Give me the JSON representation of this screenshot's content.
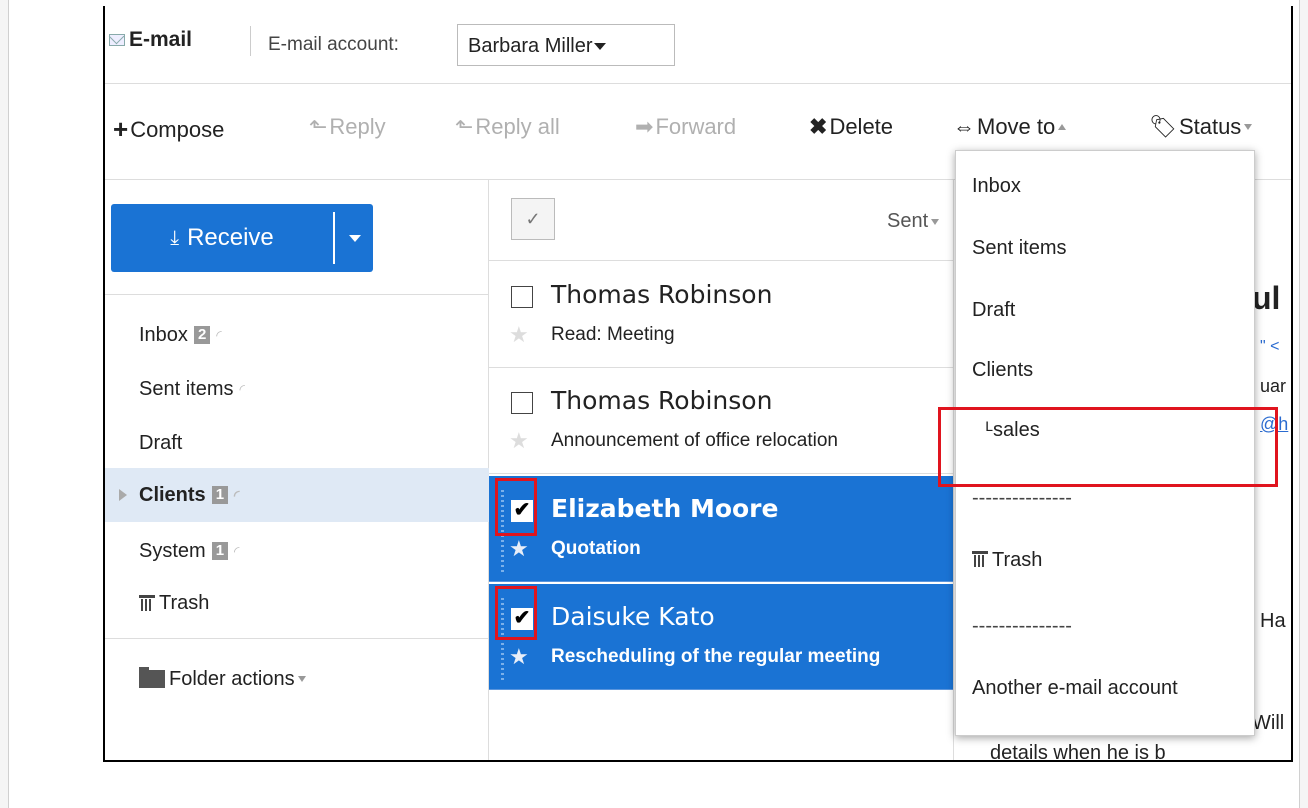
{
  "header": {
    "title": "E-mail",
    "account_label": "E-mail account:",
    "account_value": "Barbara Miller"
  },
  "toolbar": {
    "compose": "Compose",
    "reply": "Reply",
    "reply_all": "Reply all",
    "forward": "Forward",
    "delete": "Delete",
    "move_to": "Move to",
    "status": "Status"
  },
  "sidebar": {
    "receive": "Receive",
    "folders": [
      {
        "label": "Inbox",
        "badge": "2"
      },
      {
        "label": "Sent items",
        "badge": ""
      },
      {
        "label": "Draft",
        "badge": ""
      },
      {
        "label": "Clients",
        "badge": "1"
      },
      {
        "label": "System",
        "badge": "1"
      },
      {
        "label": "Trash",
        "badge": ""
      }
    ],
    "folder_actions": "Folder actions"
  },
  "list": {
    "sort_label": "Sent",
    "emails": [
      {
        "sender": "Thomas Robinson",
        "subject": "Read: Meeting",
        "checked": false
      },
      {
        "sender": "Thomas Robinson",
        "subject": "Announcement of office relocation",
        "checked": false
      },
      {
        "sender": "Elizabeth Moore",
        "subject": "Quotation",
        "checked": true
      },
      {
        "sender": "Daisuke Kato",
        "subject": "Rescheduling of the regular meeting",
        "checked": true
      }
    ]
  },
  "preview": {
    "fragments": [
      "ul",
      "\" <",
      "uar",
      "@h",
      "Ha",
      "Will",
      "details when he is b"
    ]
  },
  "move_menu": {
    "items": [
      "Inbox",
      "Sent items",
      "Draft",
      "Clients",
      "ᴸsales",
      "---------------",
      "Trash",
      "---------------",
      "Another e-mail account"
    ]
  },
  "colors": {
    "accent": "#1a73d4",
    "selected_folder": "#dfe9f5",
    "highlight_box": "#e0141e"
  }
}
